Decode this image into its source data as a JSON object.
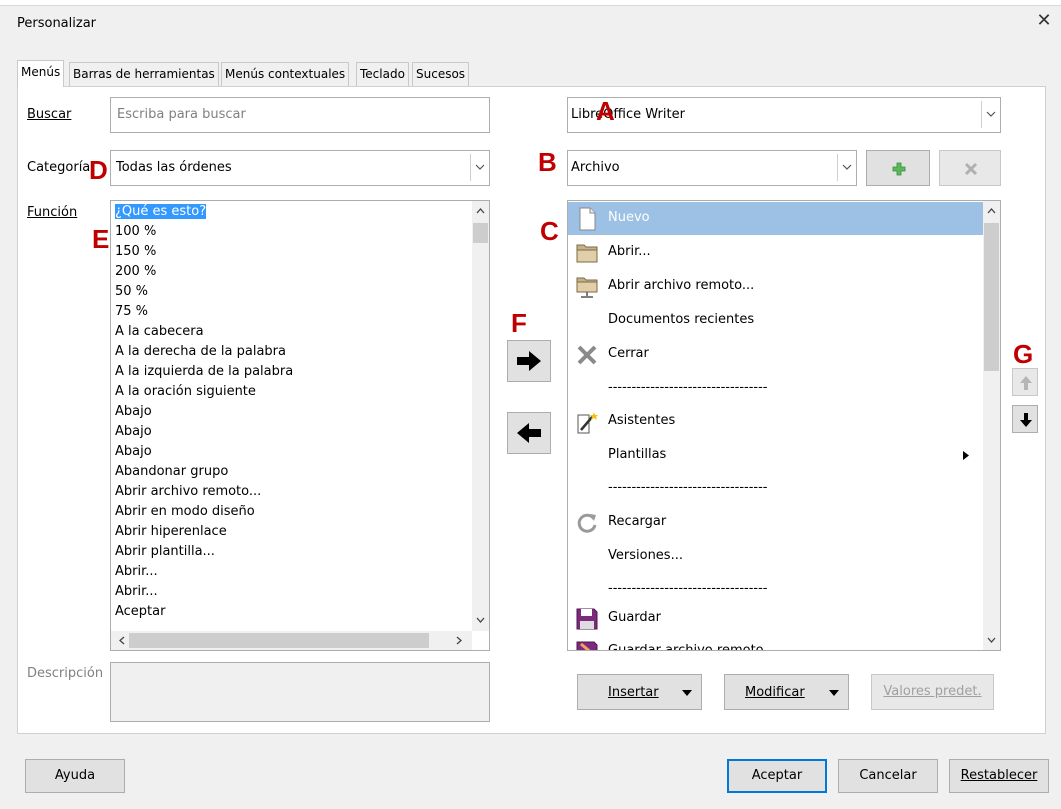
{
  "window": {
    "title": "Personalizar",
    "close_glyph": "✕"
  },
  "tabs": [
    "Menús",
    "Barras de herramientas",
    "Menús contextuales",
    "Teclado",
    "Sucesos"
  ],
  "search": {
    "label": "Buscar",
    "placeholder": "Escriba para buscar"
  },
  "category": {
    "label": "Categoría",
    "value": "Todas las órdenes"
  },
  "function_list": {
    "label": "Función",
    "items": [
      "¿Qué es esto?",
      "100 %",
      "150 %",
      "200 %",
      "50 %",
      "75 %",
      "A la cabecera",
      "A la derecha de la palabra",
      "A la izquierda de la palabra",
      "A la oración siguiente",
      "Abajo",
      "Abajo",
      "Abajo",
      "Abandonar grupo",
      "Abrir archivo remoto...",
      "Abrir en modo diseño",
      "Abrir hiperenlace",
      "Abrir plantilla...",
      "Abrir...",
      "Abrir...",
      "Aceptar"
    ]
  },
  "description": {
    "label": "Descripción"
  },
  "scope": {
    "value": "LibreOffice Writer"
  },
  "menu_select": {
    "value": "Archivo"
  },
  "menu_entries": [
    {
      "label": "Nuevo",
      "icon": "new-document-icon"
    },
    {
      "label": "Abrir...",
      "icon": "folder-open-icon"
    },
    {
      "label": "Abrir archivo remoto...",
      "icon": "remote-folder-icon"
    },
    {
      "label": "Documentos recientes",
      "icon": ""
    },
    {
      "label": "Cerrar",
      "icon": "close-x-icon"
    },
    {
      "label": "----------------------------------",
      "icon": ""
    },
    {
      "label": "Asistentes",
      "icon": "wizard-icon"
    },
    {
      "label": "Plantillas",
      "icon": ""
    },
    {
      "label": "----------------------------------",
      "icon": ""
    },
    {
      "label": "Recargar",
      "icon": "reload-icon"
    },
    {
      "label": "Versiones...",
      "icon": ""
    },
    {
      "label": "----------------------------------",
      "icon": ""
    },
    {
      "label": "Guardar",
      "icon": "save-icon"
    },
    {
      "label": "Guardar archivo remoto...",
      "icon": "save-remote-icon"
    }
  ],
  "buttons": {
    "insert": "Insertar",
    "modify": "Modificar",
    "defaults": "Valores predet.",
    "help": "Ayuda",
    "ok": "Aceptar",
    "cancel": "Cancelar",
    "reset": "Restablecer"
  },
  "annotations": {
    "a": "A",
    "b": "B",
    "c": "C",
    "d": "D",
    "e": "E",
    "f": "F",
    "g": "G"
  },
  "colors": {
    "annotation": "#c00000",
    "selection": "#3399ff",
    "menu_selection": "#9dc1e5",
    "add_icon": "#4caf50"
  }
}
